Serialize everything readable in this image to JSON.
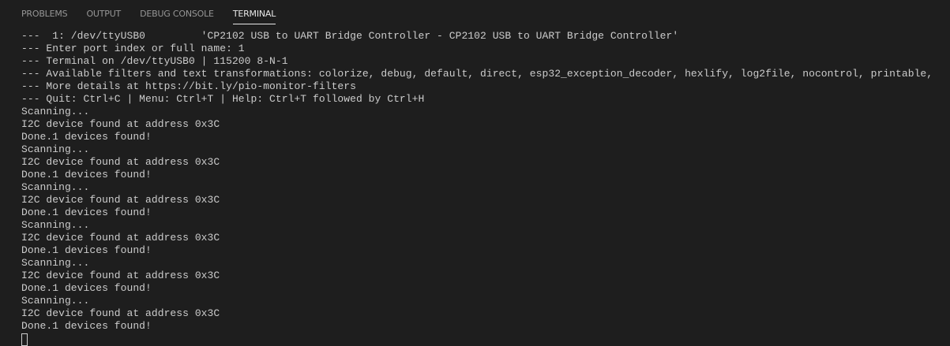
{
  "panel": {
    "tabs": [
      {
        "label": "PROBLEMS",
        "active": false
      },
      {
        "label": "OUTPUT",
        "active": false
      },
      {
        "label": "DEBUG CONSOLE",
        "active": false
      },
      {
        "label": "TERMINAL",
        "active": true
      }
    ]
  },
  "terminal": {
    "lines": [
      "---  1: /dev/ttyUSB0         'CP2102 USB to UART Bridge Controller - CP2102 USB to UART Bridge Controller'",
      "--- Enter port index or full name: 1",
      "--- Terminal on /dev/ttyUSB0 | 115200 8-N-1",
      "--- Available filters and text transformations: colorize, debug, default, direct, esp32_exception_decoder, hexlify, log2file, nocontrol, printable,",
      "--- More details at https://bit.ly/pio-monitor-filters",
      "--- Quit: Ctrl+C | Menu: Ctrl+T | Help: Ctrl+T followed by Ctrl+H",
      "Scanning...",
      "I2C device found at address 0x3C",
      "Done.1 devices found!",
      "Scanning...",
      "I2C device found at address 0x3C",
      "Done.1 devices found!",
      "Scanning...",
      "I2C device found at address 0x3C",
      "Done.1 devices found!",
      "Scanning...",
      "I2C device found at address 0x3C",
      "Done.1 devices found!",
      "Scanning...",
      "I2C device found at address 0x3C",
      "Done.1 devices found!",
      "Scanning...",
      "I2C device found at address 0x3C",
      "Done.1 devices found!"
    ]
  }
}
